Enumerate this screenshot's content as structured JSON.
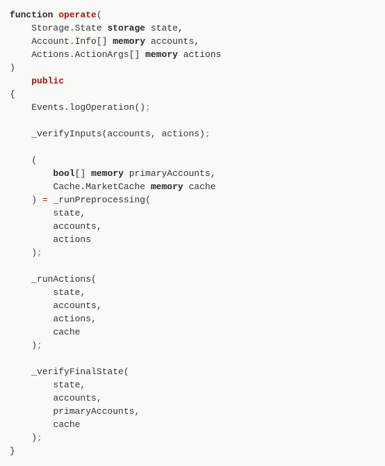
{
  "code": {
    "kw_function": "function",
    "fn_name": "operate",
    "open_paren": "(",
    "param1_type": "Storage.State",
    "kw_storage": "storage",
    "param1_name": "state,",
    "param2_type": "Account.Info[]",
    "kw_memory1": "memory",
    "param2_name": "accounts,",
    "param3_type": "Actions.ActionArgs[]",
    "kw_memory2": "memory",
    "param3_name": "actions",
    "close_paren": ")",
    "kw_public": "public",
    "open_brace": "{",
    "stmt1": "Events.logOperation()",
    "semi": ";",
    "stmt2": "_verifyInputs(accounts, actions)",
    "tuple_open": "(",
    "kw_bool": "bool",
    "arr": "[]",
    "kw_memory3": "memory",
    "tuple1_name": "primaryAccounts,",
    "tuple2_type": "Cache.MarketCache",
    "kw_memory4": "memory",
    "tuple2_name": "cache",
    "tuple_close": ")",
    "op_eq": "=",
    "call_prep": "_runPreprocessing(",
    "arg_state": "state,",
    "arg_accounts": "accounts,",
    "arg_actions": "actions",
    "call_close": ")",
    "call_run": "_runActions(",
    "arg_state2": "state,",
    "arg_accounts2": "accounts,",
    "arg_actions2": "actions,",
    "arg_cache": "cache",
    "call_close2": ")",
    "call_verify": "_verifyFinalState(",
    "arg_state3": "state,",
    "arg_accounts3": "accounts,",
    "arg_primary": "primaryAccounts,",
    "arg_cache2": "cache",
    "call_close3": ")",
    "close_brace": "}"
  }
}
